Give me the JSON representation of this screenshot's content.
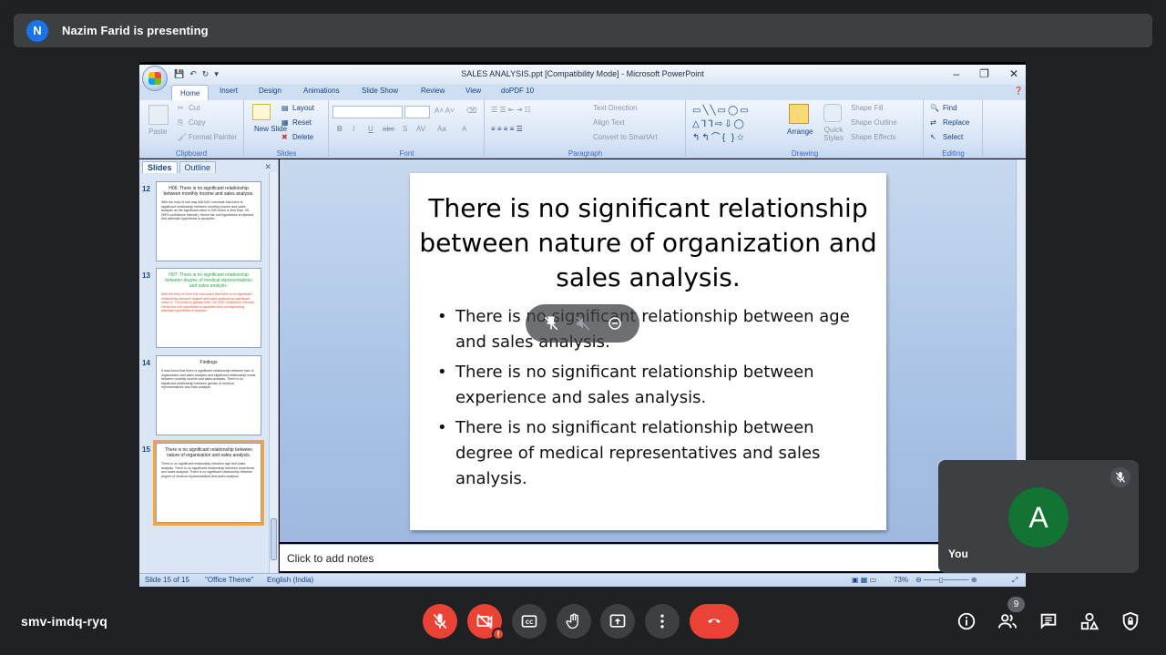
{
  "presenter": {
    "initial": "N",
    "text": "Nazim Farid is presenting"
  },
  "powerpoint": {
    "window_title": "SALES ANALYSIS.ppt [Compatibility Mode] - Microsoft PowerPoint",
    "tabs": [
      "Home",
      "Insert",
      "Design",
      "Animations",
      "Slide Show",
      "Review",
      "View",
      "doPDF 10"
    ],
    "ribbon": {
      "clipboard": {
        "label": "Clipboard",
        "paste": "Paste",
        "cut": "Cut",
        "copy": "Copy",
        "format_painter": "Format Painter"
      },
      "slides": {
        "label": "Slides",
        "new_slide": "New Slide",
        "layout": "Layout",
        "reset": "Reset",
        "delete": "Delete"
      },
      "font": {
        "label": "Font"
      },
      "paragraph": {
        "label": "Paragraph",
        "text_direction": "Text Direction",
        "align_text": "Align Text",
        "convert": "Convert to SmartArt"
      },
      "drawing": {
        "label": "Drawing",
        "arrange": "Arrange",
        "quick_styles": "Quick Styles",
        "shape_fill": "Shape Fill",
        "shape_outline": "Shape Outline",
        "shape_effects": "Shape Effects"
      },
      "editing": {
        "label": "Editing",
        "find": "Find",
        "replace": "Replace",
        "select": "Select"
      }
    },
    "panel_tabs": {
      "slides": "Slides",
      "outline": "Outline"
    },
    "thumbnails": [
      {
        "num": "12",
        "title": "H06: There is no significant relationship between monthly income and sales analysis.",
        "body": "With the help of one way ANOVA I conclude that there is significant relationship between monthly income and sales analysis as the significant value is 000 which is less than .05 (95% confidence interval). Hence the null hypothesis is rejected and alternate hypothesis is accepted."
      },
      {
        "num": "13",
        "title": "H07: There is no significant relationship between degree of medical representatives and sales analysis.",
        "body": "With the help of t-test it is concluded that there is no significant relationship between degree and sales analysis as significant value is .719 which is greater than .05 (95% confidence interval). Hence the null hypothesis is accepted and corresponding alternate hypothesis is rejected."
      },
      {
        "num": "14",
        "title": "Findings",
        "body": "It was found that there is significant relationship between size of organization and sales analysis and significant relationship exists between monthly income and sales analysis. There is no significant relationship between gender of medical representatives and Sale analysis."
      },
      {
        "num": "15",
        "title": "There is no significant relationship between nature of organization and sales analysis.",
        "body": "There is no significant relationship between age and sales analysis. There is no significant relationship between experience and sales analysis. There is no significant relationship between degree of medical representatives and sales analysis."
      }
    ],
    "slide": {
      "title": "There is no significant relationship between nature of organization and sales analysis.",
      "bullets": [
        "There is no significant relationship between age and sales analysis.",
        "There is no significant relationship between experience and sales analysis.",
        "There is no significant relationship between degree of medical representatives and sales analysis."
      ]
    },
    "notes_placeholder": "Click to add notes",
    "status": {
      "slide": "Slide 15 of 15",
      "theme": "\"Office Theme\"",
      "language": "English (India)",
      "zoom": "73%"
    }
  },
  "self_tile": {
    "initial": "A",
    "name": "You"
  },
  "meeting": {
    "code": "smv-imdq-ryq",
    "participants": "9"
  },
  "colors": {
    "accent_red": "#ea4335",
    "avatar_green": "#137333",
    "avatar_blue": "#1a73e8"
  }
}
